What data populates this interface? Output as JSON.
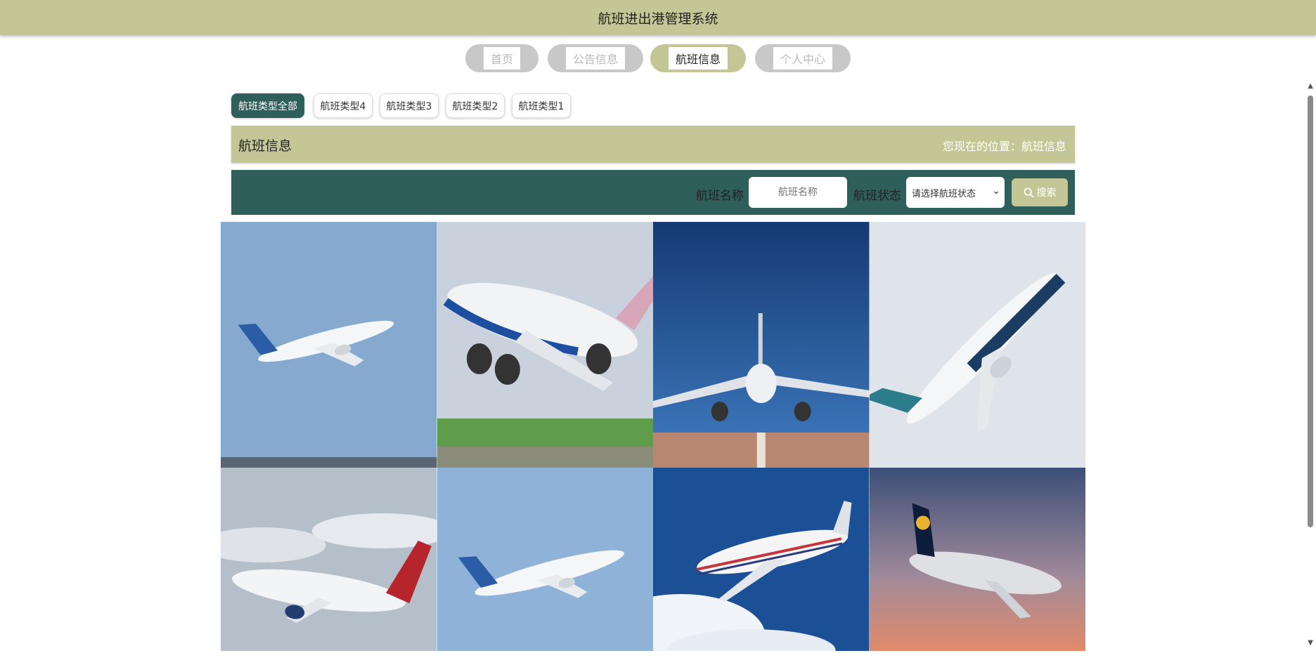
{
  "header": {
    "title": "航班进出港管理系统"
  },
  "nav": [
    {
      "label": "首页",
      "active": false
    },
    {
      "label": "公告信息",
      "active": false
    },
    {
      "label": "航班信息",
      "active": true
    },
    {
      "label": "个人中心",
      "active": false
    }
  ],
  "categories": [
    {
      "label": "航班类型全部",
      "active": true
    },
    {
      "label": "航班类型4",
      "active": false
    },
    {
      "label": "航班类型3",
      "active": false
    },
    {
      "label": "航班类型2",
      "active": false
    },
    {
      "label": "航班类型1",
      "active": false
    }
  ],
  "titlebar": {
    "title": "航班信息",
    "location": "您现在的位置：航班信息"
  },
  "search": {
    "name_label": "航班名称",
    "name_placeholder": "航班名称",
    "status_label": "航班状态",
    "status_selected": "请选择航班状态",
    "button_label": "搜索"
  },
  "flights": [
    {
      "icon": "airbus-a320-photo",
      "sky": "#86a9d0"
    },
    {
      "icon": "china-airlines-747-photo",
      "sky": "#c9d2dc"
    },
    {
      "icon": "frontal-jet-photo",
      "sky": "#1e4c8a"
    },
    {
      "icon": "boeing-737-max-photo",
      "sky": "#dfe4ea"
    },
    {
      "icon": "delta-jet-photo",
      "sky": "#b5bfca"
    },
    {
      "icon": "airbus-a320-photo-2",
      "sky": "#8fb2d8"
    },
    {
      "icon": "747-clouds-photo",
      "sky": "#1b4f96"
    },
    {
      "icon": "lufthansa-747-photo",
      "sky": "#6f7fa0"
    }
  ],
  "colors": {
    "olive": "#c4c795",
    "teal": "#2f5f5b",
    "gray_pill": "#c8c8c8"
  }
}
